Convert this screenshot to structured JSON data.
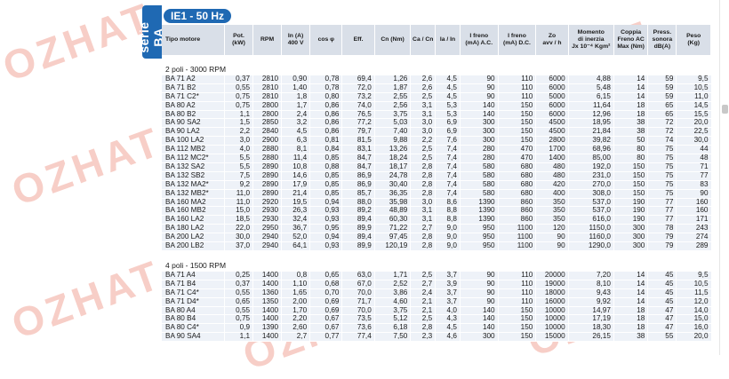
{
  "side_tab": "serie BA",
  "title": "IE1 - 50 Hz",
  "columns": [
    "Tipo motore",
    "Pot.\n(kW)",
    "RPM",
    "In (A)\n400 V",
    "cos φ",
    "Eff.",
    "Cn (Nm)",
    "Ca / Cn",
    "Ia / In",
    "I freno\n(mA) A.C.",
    "I freno\n(mA) D.C.",
    "Zo\navv / h",
    "Momento\ndi inerzia\nJx 10⁻⁴ Kgm²",
    "Coppia\nFreno AC\nMax (Nm)",
    "Press.\nsonora\ndB(A)",
    "Peso\n(Kg)"
  ],
  "sections": [
    {
      "label": "2 poli - 3000 RPM",
      "rows": [
        [
          "BA 71 A2",
          "0,37",
          "2810",
          "0,90",
          "0,78",
          "69,4",
          "1,26",
          "2,6",
          "4,5",
          "90",
          "110",
          "6000",
          "4,88",
          "14",
          "59",
          "9,5"
        ],
        [
          "BA 71 B2",
          "0,55",
          "2810",
          "1,40",
          "0,78",
          "72,0",
          "1,87",
          "2,6",
          "4,5",
          "90",
          "110",
          "6000",
          "5,48",
          "14",
          "59",
          "10,5"
        ],
        [
          "BA 71 C2*",
          "0,75",
          "2810",
          "1,8",
          "0,80",
          "73,2",
          "2,55",
          "2,5",
          "4,5",
          "90",
          "110",
          "5000",
          "6,15",
          "14",
          "59",
          "11,0"
        ],
        [
          "BA 80 A2",
          "0,75",
          "2800",
          "1,7",
          "0,86",
          "74,0",
          "2,56",
          "3,1",
          "5,3",
          "140",
          "150",
          "6000",
          "11,64",
          "18",
          "65",
          "14,5"
        ],
        [
          "BA 80 B2",
          "1,1",
          "2800",
          "2,4",
          "0,86",
          "76,5",
          "3,75",
          "3,1",
          "5,3",
          "140",
          "150",
          "6000",
          "12,96",
          "18",
          "65",
          "15,5"
        ],
        [
          "BA 90 SA2",
          "1,5",
          "2850",
          "3,2",
          "0,86",
          "77,2",
          "5,03",
          "3,0",
          "6,9",
          "300",
          "150",
          "4500",
          "18,95",
          "38",
          "72",
          "20,0"
        ],
        [
          "BA 90 LA2",
          "2,2",
          "2840",
          "4,5",
          "0,86",
          "79,7",
          "7,40",
          "3,0",
          "6,9",
          "300",
          "150",
          "4500",
          "21,84",
          "38",
          "72",
          "22,5"
        ],
        [
          "BA 100 LA2",
          "3,0",
          "2900",
          "6,3",
          "0,81",
          "81,5",
          "9,88",
          "2,2",
          "7,6",
          "300",
          "150",
          "2800",
          "39,82",
          "50",
          "74",
          "30,0"
        ],
        [
          "BA 112 MB2",
          "4,0",
          "2880",
          "8,1",
          "0,84",
          "83,1",
          "13,26",
          "2,5",
          "7,4",
          "280",
          "470",
          "1700",
          "68,96",
          "80",
          "75",
          "44"
        ],
        [
          "BA 112 MC2*",
          "5,5",
          "2880",
          "11,4",
          "0,85",
          "84,7",
          "18,24",
          "2,5",
          "7,4",
          "280",
          "470",
          "1400",
          "85,00",
          "80",
          "75",
          "48"
        ],
        [
          "BA 132 SA2",
          "5,5",
          "2890",
          "10,8",
          "0,88",
          "84,7",
          "18,17",
          "2,8",
          "7,4",
          "580",
          "680",
          "480",
          "192,0",
          "150",
          "75",
          "71"
        ],
        [
          "BA 132 SB2",
          "7,5",
          "2890",
          "14,6",
          "0,85",
          "86,9",
          "24,78",
          "2,8",
          "7,4",
          "580",
          "680",
          "480",
          "231,0",
          "150",
          "75",
          "77"
        ],
        [
          "BA 132 MA2*",
          "9,2",
          "2890",
          "17,9",
          "0,85",
          "86,9",
          "30,40",
          "2,8",
          "7,4",
          "580",
          "680",
          "420",
          "270,0",
          "150",
          "75",
          "83"
        ],
        [
          "BA 132 MB2*",
          "11,0",
          "2890",
          "21,4",
          "0,85",
          "85,7",
          "36,35",
          "2,8",
          "7,4",
          "580",
          "680",
          "400",
          "308,0",
          "150",
          "75",
          "90"
        ],
        [
          "BA 160 MA2",
          "11,0",
          "2920",
          "19,5",
          "0,94",
          "88,0",
          "35,98",
          "3,0",
          "8,6",
          "1390",
          "860",
          "350",
          "537,0",
          "190",
          "77",
          "160"
        ],
        [
          "BA 160 MB2",
          "15,0",
          "2930",
          "26,3",
          "0,93",
          "89,2",
          "48,89",
          "3,1",
          "8,8",
          "1390",
          "860",
          "350",
          "537,0",
          "190",
          "77",
          "160"
        ],
        [
          "BA 160 LA2",
          "18,5",
          "2930",
          "32,4",
          "0,93",
          "89,4",
          "60,30",
          "3,1",
          "8,8",
          "1390",
          "860",
          "350",
          "616,0",
          "190",
          "77",
          "171"
        ],
        [
          "BA 180 LA2",
          "22,0",
          "2950",
          "36,7",
          "0,95",
          "89,9",
          "71,22",
          "2,7",
          "9,0",
          "950",
          "1100",
          "120",
          "1150,0",
          "300",
          "78",
          "243"
        ],
        [
          "BA 200 LA2",
          "30,0",
          "2940",
          "52,0",
          "0,94",
          "89,4",
          "97,45",
          "2,8",
          "9,0",
          "950",
          "1100",
          "90",
          "1160,0",
          "300",
          "79",
          "274"
        ],
        [
          "BA 200 LB2",
          "37,0",
          "2940",
          "64,1",
          "0,93",
          "89,9",
          "120,19",
          "2,8",
          "9,0",
          "950",
          "1100",
          "90",
          "1290,0",
          "300",
          "79",
          "289"
        ]
      ]
    },
    {
      "label": "4 poli - 1500 RPM",
      "rows": [
        [
          "BA 71 A4",
          "0,25",
          "1400",
          "0,8",
          "0,65",
          "63,0",
          "1,71",
          "2,5",
          "3,7",
          "90",
          "110",
          "20000",
          "7,20",
          "14",
          "45",
          "9,5"
        ],
        [
          "BA 71 B4",
          "0,37",
          "1400",
          "1,10",
          "0,68",
          "67,0",
          "2,52",
          "2,7",
          "3,9",
          "90",
          "110",
          "19000",
          "8,10",
          "14",
          "45",
          "10,5"
        ],
        [
          "BA 71 C4*",
          "0,55",
          "1360",
          "1,65",
          "0,70",
          "70,0",
          "3,86",
          "2,4",
          "3,7",
          "90",
          "110",
          "18000",
          "9,43",
          "14",
          "45",
          "11,5"
        ],
        [
          "BA 71 D4*",
          "0,65",
          "1350",
          "2,00",
          "0,69",
          "71,7",
          "4,60",
          "2,1",
          "3,7",
          "90",
          "110",
          "16000",
          "9,92",
          "14",
          "45",
          "12,0"
        ],
        [
          "BA 80 A4",
          "0,55",
          "1400",
          "1,70",
          "0,69",
          "70,0",
          "3,75",
          "2,1",
          "4,0",
          "140",
          "150",
          "10000",
          "14,97",
          "18",
          "47",
          "14,0"
        ],
        [
          "BA 80 B4",
          "0,75",
          "1400",
          "2,20",
          "0,67",
          "73,5",
          "5,12",
          "2,5",
          "4,3",
          "140",
          "150",
          "10000",
          "17,19",
          "18",
          "47",
          "15,0"
        ],
        [
          "BA 80 C4*",
          "0,9",
          "1390",
          "2,60",
          "0,67",
          "73,6",
          "6,18",
          "2,8",
          "4,5",
          "140",
          "150",
          "10000",
          "18,30",
          "18",
          "47",
          "16,0"
        ],
        [
          "BA 90 SA4",
          "1,1",
          "1400",
          "2,7",
          "0,77",
          "77,4",
          "7,50",
          "2,3",
          "4,6",
          "300",
          "150",
          "15000",
          "26,15",
          "38",
          "55",
          "20,0"
        ]
      ]
    }
  ],
  "watermark": "OZHAT"
}
